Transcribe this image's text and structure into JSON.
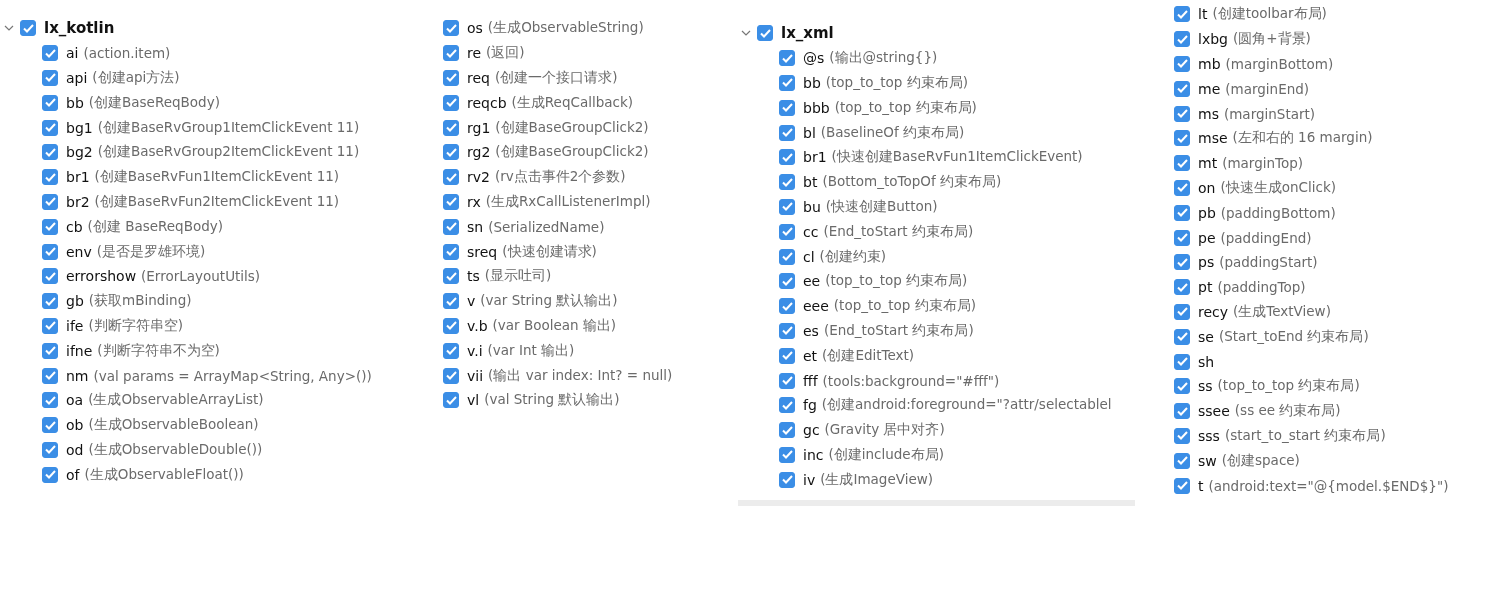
{
  "panels": [
    {
      "group": {
        "name": "lx_kotlin",
        "checked": true,
        "expanded": true
      },
      "items": [
        {
          "abbr": "ai",
          "description": "(action.item)",
          "checked": true
        },
        {
          "abbr": "api",
          "description": "(创建api方法)",
          "checked": true
        },
        {
          "abbr": "bb",
          "description": "(创建BaseReqBody)",
          "checked": true
        },
        {
          "abbr": "bg1",
          "description": "(创建BaseRvGroup1ItemClickEvent 11)",
          "checked": true
        },
        {
          "abbr": "bg2",
          "description": "(创建BaseRvGroup2ItemClickEvent 11)",
          "checked": true
        },
        {
          "abbr": "br1",
          "description": "(创建BaseRvFun1ItemClickEvent 11)",
          "checked": true
        },
        {
          "abbr": "br2",
          "description": "(创建BaseRvFun2ItemClickEvent 11)",
          "checked": true
        },
        {
          "abbr": "cb",
          "description": "(创建 BaseReqBody)",
          "checked": true
        },
        {
          "abbr": "env",
          "description": "(是否是罗雄环境)",
          "checked": true
        },
        {
          "abbr": "errorshow",
          "description": "(ErrorLayoutUtils)",
          "checked": true
        },
        {
          "abbr": "gb",
          "description": "(获取mBinding)",
          "checked": true
        },
        {
          "abbr": "ife",
          "description": "(判断字符串空)",
          "checked": true
        },
        {
          "abbr": "ifne",
          "description": "(判断字符串不为空)",
          "checked": true
        },
        {
          "abbr": "nm",
          "description": "(val params = ArrayMap<String, Any>())",
          "checked": true
        },
        {
          "abbr": "oa",
          "description": "(生成ObservableArrayList)",
          "checked": true
        },
        {
          "abbr": "ob",
          "description": "(生成ObservableBoolean)",
          "checked": true
        },
        {
          "abbr": "od",
          "description": "(生成ObservableDouble())",
          "checked": true
        },
        {
          "abbr": "of",
          "description": "(生成ObservableFloat())",
          "checked": true
        }
      ]
    },
    {
      "items": [
        {
          "abbr": "os",
          "description": "(生成ObservableString)",
          "checked": true
        },
        {
          "abbr": "re",
          "description": "(返回)",
          "checked": true
        },
        {
          "abbr": "req",
          "description": "(创建一个接口请求)",
          "checked": true
        },
        {
          "abbr": "reqcb",
          "description": "(生成ReqCallback)",
          "checked": true
        },
        {
          "abbr": "rg1",
          "description": "(创建BaseGroupClick2)",
          "checked": true
        },
        {
          "abbr": "rg2",
          "description": "(创建BaseGroupClick2)",
          "checked": true
        },
        {
          "abbr": "rv2",
          "description": "(rv点击事件2个参数)",
          "checked": true
        },
        {
          "abbr": "rx",
          "description": "(生成RxCallListenerImpl)",
          "checked": true
        },
        {
          "abbr": "sn",
          "description": "(SerializedName)",
          "checked": true
        },
        {
          "abbr": "sreq",
          "description": "(快速创建请求)",
          "checked": true
        },
        {
          "abbr": "ts",
          "description": "(显示吐司)",
          "checked": true
        },
        {
          "abbr": "v",
          "description": "(var String 默认输出)",
          "checked": true
        },
        {
          "abbr": "v.b",
          "description": "(var Boolean 输出)",
          "checked": true
        },
        {
          "abbr": "v.i",
          "description": "(var Int 输出)",
          "checked": true
        },
        {
          "abbr": "vii",
          "description": "(输出  var index: Int? = null)",
          "checked": true
        },
        {
          "abbr": "vl",
          "description": "(val String 默认输出)",
          "checked": true
        }
      ]
    },
    {
      "group": {
        "name": "lx_xml",
        "checked": true,
        "expanded": true
      },
      "items": [
        {
          "abbr": "@s",
          "description": "(输出@string{})",
          "checked": true
        },
        {
          "abbr": "bb",
          "description": "(top_to_top 约束布局)",
          "checked": true
        },
        {
          "abbr": "bbb",
          "description": "(top_to_top 约束布局)",
          "checked": true
        },
        {
          "abbr": "bl",
          "description": "(BaselineOf 约束布局)",
          "checked": true
        },
        {
          "abbr": "br1",
          "description": "(快速创建BaseRvFun1ItemClickEvent)",
          "checked": true
        },
        {
          "abbr": "bt",
          "description": "(Bottom_toTopOf  约束布局)",
          "checked": true
        },
        {
          "abbr": "bu",
          "description": "(快速创建Button)",
          "checked": true
        },
        {
          "abbr": "cc",
          "description": "(End_toStart 约束布局)",
          "checked": true
        },
        {
          "abbr": "cl",
          "description": "(创建约束)",
          "checked": true
        },
        {
          "abbr": "ee",
          "description": "(top_to_top 约束布局)",
          "checked": true
        },
        {
          "abbr": "eee",
          "description": "(top_to_top 约束布局)",
          "checked": true
        },
        {
          "abbr": "es",
          "description": "(End_toStart 约束布局)",
          "checked": true
        },
        {
          "abbr": "et",
          "description": "(创建EditText)",
          "checked": true
        },
        {
          "abbr": "fff",
          "description": "(tools:background=\"#fff\")",
          "checked": true
        },
        {
          "abbr": "fg",
          "description": "(创建android:foreground=\"?attr/selectablel",
          "checked": true
        },
        {
          "abbr": "gc",
          "description": "(Gravity 居中对齐)",
          "checked": true
        },
        {
          "abbr": "inc",
          "description": "(创建include布局)",
          "checked": true
        },
        {
          "abbr": "iv",
          "description": "(生成ImageView)",
          "checked": true
        }
      ]
    },
    {
      "items": [
        {
          "abbr": "lt",
          "description": "(创建toolbar布局)",
          "checked": true
        },
        {
          "abbr": "lxbg",
          "description": "(圆角+背景)",
          "checked": true
        },
        {
          "abbr": "mb",
          "description": "(marginBottom)",
          "checked": true
        },
        {
          "abbr": "me",
          "description": "(marginEnd)",
          "checked": true
        },
        {
          "abbr": "ms",
          "description": "(marginStart)",
          "checked": true
        },
        {
          "abbr": "mse",
          "description": "(左和右的 16 margin)",
          "checked": true
        },
        {
          "abbr": "mt",
          "description": "(marginTop)",
          "checked": true
        },
        {
          "abbr": "on",
          "description": "(快速生成onClick)",
          "checked": true
        },
        {
          "abbr": "pb",
          "description": "(paddingBottom)",
          "checked": true
        },
        {
          "abbr": "pe",
          "description": "(paddingEnd)",
          "checked": true
        },
        {
          "abbr": "ps",
          "description": "(paddingStart)",
          "checked": true
        },
        {
          "abbr": "pt",
          "description": "(paddingTop)",
          "checked": true
        },
        {
          "abbr": "recy",
          "description": "(生成TextView)",
          "checked": true
        },
        {
          "abbr": "se",
          "description": "(Start_toEnd 约束布局)",
          "checked": true
        },
        {
          "abbr": "sh",
          "checked": true
        },
        {
          "abbr": "ss",
          "description": "(top_to_top 约束布局)",
          "checked": true
        },
        {
          "abbr": "ssee",
          "description": "(ss ee  约束布局)",
          "checked": true
        },
        {
          "abbr": "sss",
          "description": "(start_to_start 约束布局)",
          "checked": true
        },
        {
          "abbr": "sw",
          "description": "(创建space)",
          "checked": true
        },
        {
          "abbr": "t",
          "description": "(android:text=\"@{model.$END$}\")",
          "checked": true
        }
      ]
    }
  ]
}
